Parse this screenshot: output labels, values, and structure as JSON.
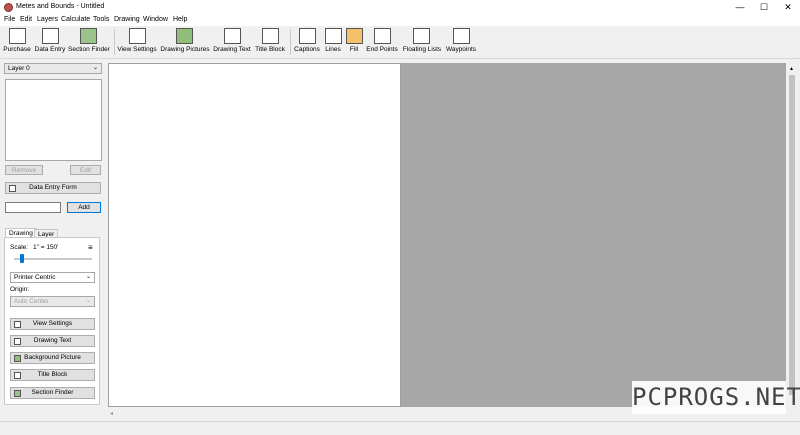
{
  "window": {
    "title": "Metes and Bounds - Untitled",
    "minimize": "—",
    "maximize": "☐",
    "close": "✕"
  },
  "menu": [
    "File",
    "Edit",
    "Layers",
    "Calculate",
    "Tools",
    "Drawing",
    "Window",
    "Help"
  ],
  "toolbar": {
    "purchase": "Purchase",
    "data_entry": "Data Entry",
    "section_finder": "Section Finder",
    "view_settings": "View Settings",
    "drawing_pictures": "Drawing Pictures",
    "drawing_text": "Drawing Text",
    "title_block": "Title Block",
    "captions": "Captions",
    "lines": "Lines",
    "fill": "Fill",
    "end_points": "End Points",
    "floating_lists": "Floating Lists",
    "waypoints": "Waypoints"
  },
  "layers": {
    "selected": "Layer 0",
    "remove": "Remove",
    "edit": "Edit",
    "data_entry_form": "Data Entry Form",
    "input_value": "",
    "add": "Add"
  },
  "tabs": {
    "drawing": "Drawing",
    "layer": "Layer"
  },
  "drawing": {
    "scale_label": "Scale:",
    "scale_value": "1\" = 150'",
    "scale_slider_fraction": 0.1,
    "mode": "Printer Centric",
    "origin_label": "Origin:",
    "origin_value": "Auto Center",
    "view_settings": "View Settings",
    "drawing_text": "Drawing Text",
    "background_picture": "Background Picture",
    "title_block": "Title Block",
    "section_finder": "Section Finder"
  },
  "watermark": "PCPROGS.NET",
  "colors": {
    "canvas_bg": "#a7a7a7",
    "page": "#ffffff",
    "app_icon": "#c0504d"
  }
}
